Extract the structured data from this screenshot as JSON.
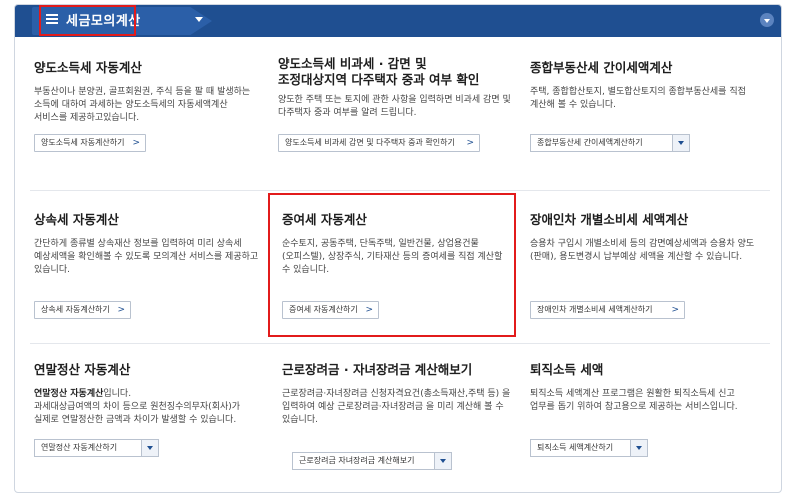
{
  "header": {
    "title": "세금모의계산"
  },
  "cards": [
    {
      "title": "양도소득세 자동계산",
      "desc": "부동산이나 분양권, 골프회원권, 주식 등을 팔 때 발생하는 소득에 대하여 과세하는 양도소득세의 자동세액계산 서비스를 제공하고있습니다.",
      "button": "양도소득세 자동계산하기"
    },
    {
      "title_line1": "양도소득세 비과세 · 감면 및",
      "title_line2": "조정대상지역 다주택자 중과 여부 확인",
      "desc": "양도한 주택 또는 토지에 관한 사항을 입력하면 비과세 감면 및 다주택자 중과 여부를 알려 드립니다.",
      "button": "양도소득세 비과세 감면 및 다주택자 중과 확인하기"
    },
    {
      "title": "종합부동산세 간이세액계산",
      "desc": "주택, 종합합산토지, 별도합산토지의 종합부동산세를 직접 계산해 볼 수 있습니다.",
      "select": "종합부동산세 간이세액계산하기"
    },
    {
      "title": "상속세 자동계산",
      "desc": "간단하게 종류별 상속재산 정보를 입력하여 미리 상속세 예상세액을 확인해볼 수 있도록 모의계산 서비스를 제공하고 있습니다.",
      "button": "상속세 자동계산하기"
    },
    {
      "title": "증여세 자동계산",
      "desc": "순수토지, 공동주택, 단독주택, 일반건물, 상업용건물 (오피스텔), 상장주식, 기타재산 등의 증여세를 직접 계산할 수 있습니다.",
      "button": "증여세 자동계산하기"
    },
    {
      "title": "장애인차 개별소비세 세액계산",
      "desc": "승용차 구입시 개별소비세 등의 감면예상세액과 승용차 양도(판매), 용도변경시 납부예상 세액을 계산할 수 있습니다.",
      "button": "장애인차 개별소비세 세액계산하기"
    },
    {
      "title": "연말정산 자동계산",
      "desc_bold": "연말정산 자동계산",
      "desc_rest": "입니다.",
      "desc2": "과세대상급여액의 차이 등으로 원천징수의무자(회사)가 실제로 연말정산한 금액과 차이가 발생할 수 있습니다.",
      "select": "연말정산 자동계산하기"
    },
    {
      "title": "근로장려금 · 자녀장려금 계산해보기",
      "desc": "근로장려금·자녀장려금 신청자격요건(총소득재산,주택 등) 을 입력하여 예상 근로장려금·자녀장려금 을 미리 계산해 볼 수 있습니다.",
      "select": "근로장려금 자녀장려금 계산해보기"
    },
    {
      "title": "퇴직소득 세액",
      "desc": "퇴직소득 세액계산 프로그램은 원활한 퇴직소득세 신고 업무를 돕기 위하여 참고용으로 제공하는 서비스입니다.",
      "select": "퇴직소득 세액계산하기"
    }
  ],
  "icons": {
    "menu": "hamburger-menu-icon",
    "dropdown": "caret-down-icon",
    "collapse": "collapse-circle-icon",
    "button_chevron": "chevron-right-icon"
  },
  "colors": {
    "header_bg": "#1f4f91",
    "header_tab": "#2b5fa8",
    "highlight": "#e21b1b"
  },
  "chevron": ">"
}
